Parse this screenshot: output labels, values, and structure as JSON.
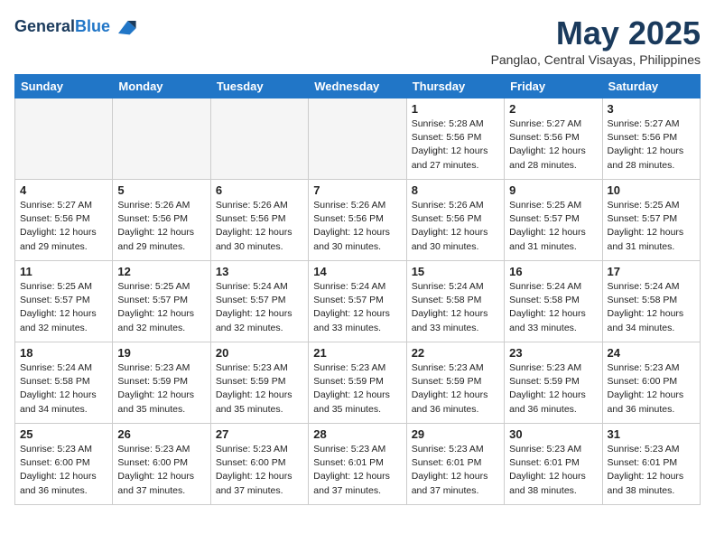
{
  "header": {
    "logo_line1": "General",
    "logo_line2": "Blue",
    "month_year": "May 2025",
    "location": "Panglao, Central Visayas, Philippines"
  },
  "weekdays": [
    "Sunday",
    "Monday",
    "Tuesday",
    "Wednesday",
    "Thursday",
    "Friday",
    "Saturday"
  ],
  "weeks": [
    [
      {
        "day": "",
        "info": "",
        "empty": true
      },
      {
        "day": "",
        "info": "",
        "empty": true
      },
      {
        "day": "",
        "info": "",
        "empty": true
      },
      {
        "day": "",
        "info": "",
        "empty": true
      },
      {
        "day": "1",
        "info": "Sunrise: 5:28 AM\nSunset: 5:56 PM\nDaylight: 12 hours\nand 27 minutes.",
        "empty": false
      },
      {
        "day": "2",
        "info": "Sunrise: 5:27 AM\nSunset: 5:56 PM\nDaylight: 12 hours\nand 28 minutes.",
        "empty": false
      },
      {
        "day": "3",
        "info": "Sunrise: 5:27 AM\nSunset: 5:56 PM\nDaylight: 12 hours\nand 28 minutes.",
        "empty": false
      }
    ],
    [
      {
        "day": "4",
        "info": "Sunrise: 5:27 AM\nSunset: 5:56 PM\nDaylight: 12 hours\nand 29 minutes.",
        "empty": false
      },
      {
        "day": "5",
        "info": "Sunrise: 5:26 AM\nSunset: 5:56 PM\nDaylight: 12 hours\nand 29 minutes.",
        "empty": false
      },
      {
        "day": "6",
        "info": "Sunrise: 5:26 AM\nSunset: 5:56 PM\nDaylight: 12 hours\nand 30 minutes.",
        "empty": false
      },
      {
        "day": "7",
        "info": "Sunrise: 5:26 AM\nSunset: 5:56 PM\nDaylight: 12 hours\nand 30 minutes.",
        "empty": false
      },
      {
        "day": "8",
        "info": "Sunrise: 5:26 AM\nSunset: 5:56 PM\nDaylight: 12 hours\nand 30 minutes.",
        "empty": false
      },
      {
        "day": "9",
        "info": "Sunrise: 5:25 AM\nSunset: 5:57 PM\nDaylight: 12 hours\nand 31 minutes.",
        "empty": false
      },
      {
        "day": "10",
        "info": "Sunrise: 5:25 AM\nSunset: 5:57 PM\nDaylight: 12 hours\nand 31 minutes.",
        "empty": false
      }
    ],
    [
      {
        "day": "11",
        "info": "Sunrise: 5:25 AM\nSunset: 5:57 PM\nDaylight: 12 hours\nand 32 minutes.",
        "empty": false
      },
      {
        "day": "12",
        "info": "Sunrise: 5:25 AM\nSunset: 5:57 PM\nDaylight: 12 hours\nand 32 minutes.",
        "empty": false
      },
      {
        "day": "13",
        "info": "Sunrise: 5:24 AM\nSunset: 5:57 PM\nDaylight: 12 hours\nand 32 minutes.",
        "empty": false
      },
      {
        "day": "14",
        "info": "Sunrise: 5:24 AM\nSunset: 5:57 PM\nDaylight: 12 hours\nand 33 minutes.",
        "empty": false
      },
      {
        "day": "15",
        "info": "Sunrise: 5:24 AM\nSunset: 5:58 PM\nDaylight: 12 hours\nand 33 minutes.",
        "empty": false
      },
      {
        "day": "16",
        "info": "Sunrise: 5:24 AM\nSunset: 5:58 PM\nDaylight: 12 hours\nand 33 minutes.",
        "empty": false
      },
      {
        "day": "17",
        "info": "Sunrise: 5:24 AM\nSunset: 5:58 PM\nDaylight: 12 hours\nand 34 minutes.",
        "empty": false
      }
    ],
    [
      {
        "day": "18",
        "info": "Sunrise: 5:24 AM\nSunset: 5:58 PM\nDaylight: 12 hours\nand 34 minutes.",
        "empty": false
      },
      {
        "day": "19",
        "info": "Sunrise: 5:23 AM\nSunset: 5:59 PM\nDaylight: 12 hours\nand 35 minutes.",
        "empty": false
      },
      {
        "day": "20",
        "info": "Sunrise: 5:23 AM\nSunset: 5:59 PM\nDaylight: 12 hours\nand 35 minutes.",
        "empty": false
      },
      {
        "day": "21",
        "info": "Sunrise: 5:23 AM\nSunset: 5:59 PM\nDaylight: 12 hours\nand 35 minutes.",
        "empty": false
      },
      {
        "day": "22",
        "info": "Sunrise: 5:23 AM\nSunset: 5:59 PM\nDaylight: 12 hours\nand 36 minutes.",
        "empty": false
      },
      {
        "day": "23",
        "info": "Sunrise: 5:23 AM\nSunset: 5:59 PM\nDaylight: 12 hours\nand 36 minutes.",
        "empty": false
      },
      {
        "day": "24",
        "info": "Sunrise: 5:23 AM\nSunset: 6:00 PM\nDaylight: 12 hours\nand 36 minutes.",
        "empty": false
      }
    ],
    [
      {
        "day": "25",
        "info": "Sunrise: 5:23 AM\nSunset: 6:00 PM\nDaylight: 12 hours\nand 36 minutes.",
        "empty": false
      },
      {
        "day": "26",
        "info": "Sunrise: 5:23 AM\nSunset: 6:00 PM\nDaylight: 12 hours\nand 37 minutes.",
        "empty": false
      },
      {
        "day": "27",
        "info": "Sunrise: 5:23 AM\nSunset: 6:00 PM\nDaylight: 12 hours\nand 37 minutes.",
        "empty": false
      },
      {
        "day": "28",
        "info": "Sunrise: 5:23 AM\nSunset: 6:01 PM\nDaylight: 12 hours\nand 37 minutes.",
        "empty": false
      },
      {
        "day": "29",
        "info": "Sunrise: 5:23 AM\nSunset: 6:01 PM\nDaylight: 12 hours\nand 37 minutes.",
        "empty": false
      },
      {
        "day": "30",
        "info": "Sunrise: 5:23 AM\nSunset: 6:01 PM\nDaylight: 12 hours\nand 38 minutes.",
        "empty": false
      },
      {
        "day": "31",
        "info": "Sunrise: 5:23 AM\nSunset: 6:01 PM\nDaylight: 12 hours\nand 38 minutes.",
        "empty": false
      }
    ]
  ]
}
